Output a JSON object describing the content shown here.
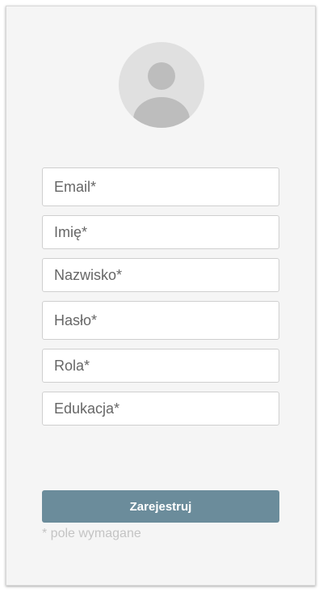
{
  "avatar": {
    "icon": "user-placeholder-icon"
  },
  "form": {
    "email_placeholder": "Email*",
    "first_name_placeholder": "Imię*",
    "last_name_placeholder": "Nazwisko*",
    "password_placeholder": "Hasło*",
    "role_placeholder": "Rola*",
    "education_placeholder": "Edukacja*",
    "submit_label": "Zarejestruj",
    "required_note": "* pole wymagane"
  },
  "colors": {
    "button": "#6b8c9b",
    "card_background": "#f5f5f5",
    "avatar_background": "#e0e0e0",
    "avatar_figure": "#bdbdbd"
  }
}
